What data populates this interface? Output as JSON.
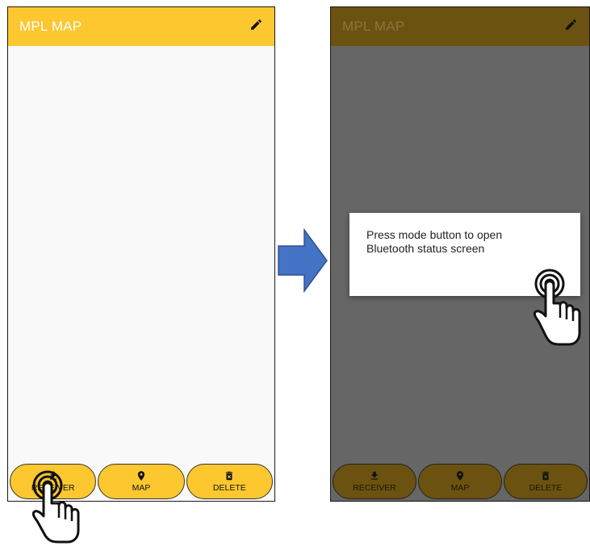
{
  "left_screen": {
    "title": "MPL MAP",
    "edit_icon": "pencil-icon",
    "nav": [
      {
        "label": "RECEIVER",
        "icon": "download-icon"
      },
      {
        "label": "MAP",
        "icon": "map-pin-icon"
      },
      {
        "label": "DELETE",
        "icon": "trash-icon"
      }
    ]
  },
  "right_screen": {
    "title": "MPL MAP",
    "edit_icon": "pencil-icon",
    "dialog": {
      "message": "Press mode button to open\nBluetooth status screen"
    },
    "nav": [
      {
        "label": "RECEIVER",
        "icon": "download-icon"
      },
      {
        "label": "MAP",
        "icon": "map-pin-icon"
      },
      {
        "label": "DELETE",
        "icon": "trash-icon"
      }
    ]
  },
  "transition_icon": "right-arrow-icon",
  "gesture_icon": "tap-hand-icon",
  "colors": {
    "appbar": "#fdc72f",
    "appbar_dimmed": "#6b5210",
    "overlay": "#666666",
    "arrow": "#4472c4"
  }
}
